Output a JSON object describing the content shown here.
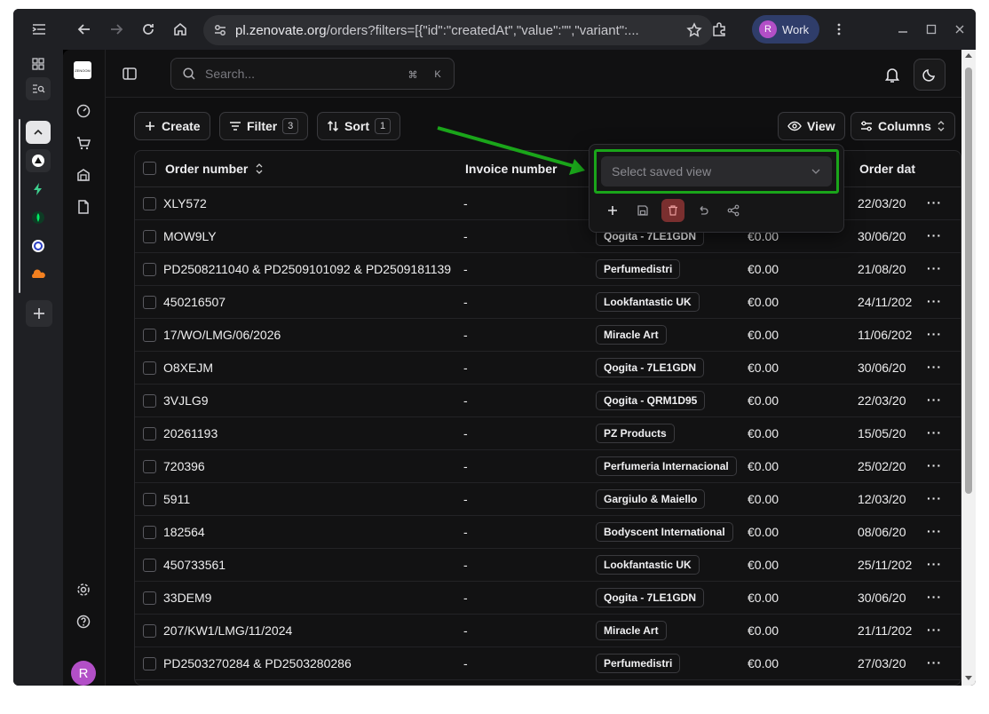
{
  "browser": {
    "url_domain": "pl.zenovate.org",
    "url_path": "/orders?filters=[{\"id\":\"createdAt\",\"value\":\"\",\"variant\":...",
    "profile_initial": "R",
    "profile_label": "Work"
  },
  "app": {
    "logo_text": "ZENOOM",
    "search_placeholder": "Search...",
    "search_kbd_1": "⌘",
    "search_kbd_2": "K",
    "user_initial": "R"
  },
  "toolbar": {
    "create_label": "Create",
    "filter_label": "Filter",
    "filter_count": "3",
    "sort_label": "Sort",
    "sort_count": "1",
    "view_label": "View",
    "columns_label": "Columns"
  },
  "saved_view": {
    "placeholder": "Select saved view"
  },
  "table": {
    "headers": {
      "order_number": "Order number",
      "invoice_number": "Invoice number",
      "order_date": "Order dat"
    },
    "rows": [
      {
        "order": "XLY572",
        "invoice": "-",
        "supplier": "",
        "amount": "",
        "date": "22/03/20"
      },
      {
        "order": "MOW9LY",
        "invoice": "-",
        "supplier": "Qogita - 7LE1GDN",
        "amount": "€0.00",
        "date": "30/06/20"
      },
      {
        "order": "PD2508211040 & PD2509101092 & PD2509181139",
        "invoice": "-",
        "supplier": "Perfumedistri",
        "amount": "€0.00",
        "date": "21/08/20"
      },
      {
        "order": "450216507",
        "invoice": "-",
        "supplier": "Lookfantastic UK",
        "amount": "€0.00",
        "date": "24/11/202"
      },
      {
        "order": "17/WO/LMG/06/2026",
        "invoice": "-",
        "supplier": "Miracle Art",
        "amount": "€0.00",
        "date": "11/06/202"
      },
      {
        "order": "O8XEJM",
        "invoice": "-",
        "supplier": "Qogita - 7LE1GDN",
        "amount": "€0.00",
        "date": "30/06/20"
      },
      {
        "order": "3VJLG9",
        "invoice": "-",
        "supplier": "Qogita - QRM1D95",
        "amount": "€0.00",
        "date": "22/03/20"
      },
      {
        "order": "20261193",
        "invoice": "-",
        "supplier": "PZ Products",
        "amount": "€0.00",
        "date": "15/05/20"
      },
      {
        "order": "720396",
        "invoice": "-",
        "supplier": "Perfumeria Internacional",
        "amount": "€0.00",
        "date": "25/02/20"
      },
      {
        "order": "5911",
        "invoice": "-",
        "supplier": "Gargiulo & Maiello",
        "amount": "€0.00",
        "date": "12/03/20"
      },
      {
        "order": "182564",
        "invoice": "-",
        "supplier": "Bodyscent International",
        "amount": "€0.00",
        "date": "08/06/20"
      },
      {
        "order": "450733561",
        "invoice": "-",
        "supplier": "Lookfantastic UK",
        "amount": "€0.00",
        "date": "25/11/202"
      },
      {
        "order": "33DEM9",
        "invoice": "-",
        "supplier": "Qogita - 7LE1GDN",
        "amount": "€0.00",
        "date": "30/06/20"
      },
      {
        "order": "207/KW1/LMG/11/2024",
        "invoice": "-",
        "supplier": "Miracle Art",
        "amount": "€0.00",
        "date": "21/11/202"
      },
      {
        "order": "PD2503270284 & PD2503280286",
        "invoice": "-",
        "supplier": "Perfumedistri",
        "amount": "€0.00",
        "date": "27/03/20"
      }
    ]
  },
  "colors": {
    "annotation_green": "#1aa51a",
    "avatar_purple": "#b24fc7",
    "delete_red": "#7a2f2f"
  }
}
